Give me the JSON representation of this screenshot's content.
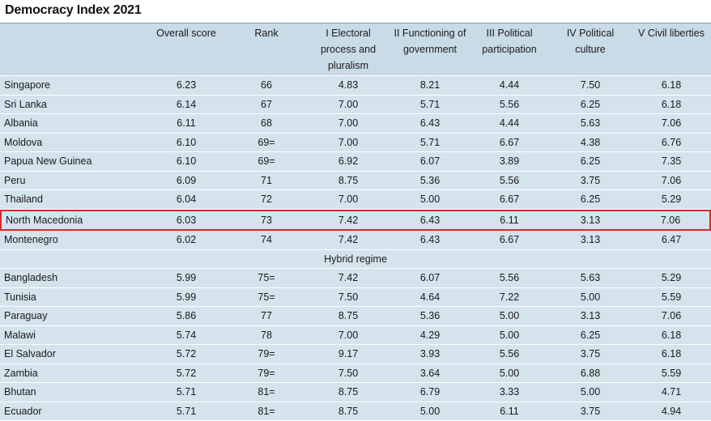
{
  "title": "Democracy Index 2021",
  "headers": [
    "",
    "Overall score",
    "Rank",
    "I Electoral process and pluralism",
    "II Functioning of government",
    "III Political participation",
    "IV Political culture",
    "V Civil liberties"
  ],
  "rows_top": [
    [
      "Singapore",
      "6.23",
      "66",
      "4.83",
      "8.21",
      "4.44",
      "7.50",
      "6.18"
    ],
    [
      "Sri Lanka",
      "6.14",
      "67",
      "7.00",
      "5.71",
      "5.56",
      "6.25",
      "6.18"
    ],
    [
      "Albania",
      "6.11",
      "68",
      "7.00",
      "6.43",
      "4.44",
      "5.63",
      "7.06"
    ],
    [
      "Moldova",
      "6.10",
      "69=",
      "7.00",
      "5.71",
      "6.67",
      "4.38",
      "6.76"
    ],
    [
      "Papua New Guinea",
      "6.10",
      "69=",
      "6.92",
      "6.07",
      "3.89",
      "6.25",
      "7.35"
    ],
    [
      "Peru",
      "6.09",
      "71",
      "8.75",
      "5.36",
      "5.56",
      "3.75",
      "7.06"
    ],
    [
      "Thailand",
      "6.04",
      "72",
      "7.00",
      "5.00",
      "6.67",
      "6.25",
      "5.29"
    ],
    [
      "North Macedonia",
      "6.03",
      "73",
      "7.42",
      "6.43",
      "6.11",
      "3.13",
      "7.06"
    ],
    [
      "Montenegro",
      "6.02",
      "74",
      "7.42",
      "6.43",
      "6.67",
      "3.13",
      "6.47"
    ]
  ],
  "section_label": "Hybrid regime",
  "rows_bottom": [
    [
      "Bangladesh",
      "5.99",
      "75=",
      "7.42",
      "6.07",
      "5.56",
      "5.63",
      "5.29"
    ],
    [
      "Tunisia",
      "5.99",
      "75=",
      "7.50",
      "4.64",
      "7.22",
      "5.00",
      "5.59"
    ],
    [
      "Paraguay",
      "5.86",
      "77",
      "8.75",
      "5.36",
      "5.00",
      "3.13",
      "7.06"
    ],
    [
      "Malawi",
      "5.74",
      "78",
      "7.00",
      "4.29",
      "5.00",
      "6.25",
      "6.18"
    ],
    [
      "El Salvador",
      "5.72",
      "79=",
      "9.17",
      "3.93",
      "5.56",
      "3.75",
      "6.18"
    ],
    [
      "Zambia",
      "5.72",
      "79=",
      "7.50",
      "3.64",
      "5.00",
      "6.88",
      "5.59"
    ],
    [
      "Bhutan",
      "5.71",
      "81=",
      "8.75",
      "6.79",
      "3.33",
      "5.00",
      "4.71"
    ],
    [
      "Ecuador",
      "5.71",
      "81=",
      "8.75",
      "5.00",
      "6.11",
      "3.75",
      "4.94"
    ]
  ],
  "highlight_country": "North Macedonia",
  "colors": {
    "header_bg": "#c9dbe6",
    "row_bg": "#d4e3ec",
    "highlight": "#d72a2a"
  }
}
